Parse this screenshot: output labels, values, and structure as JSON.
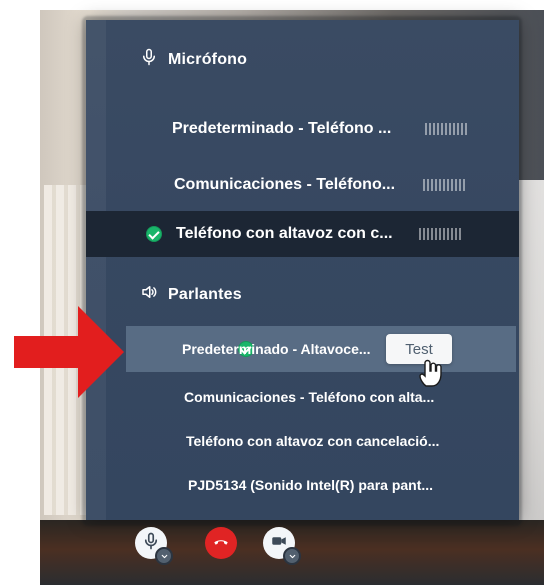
{
  "microphone": {
    "title": "Micrófono",
    "devices": [
      {
        "name": "Predeterminado - Teléfono ...",
        "selected": false
      },
      {
        "name": "Comunicaciones - Teléfono...",
        "selected": false
      },
      {
        "name": "Teléfono con altavoz con c...",
        "selected": true
      }
    ]
  },
  "speakers": {
    "title": "Parlantes",
    "devices": [
      {
        "name": "Predeterminado - Altavoce...",
        "selected": true
      },
      {
        "name": "Comunicaciones - Teléfono con alta...",
        "selected": false
      },
      {
        "name": "Teléfono con altavoz con cancelació...",
        "selected": false
      },
      {
        "name": "PJD5134 (Sonido Intel(R) para pant...",
        "selected": false
      }
    ],
    "test_label": "Test"
  },
  "controls": {
    "mic": "mic-icon",
    "hangup": "phone-hangup-icon",
    "camera": "video-camera-icon"
  },
  "colors": {
    "panel": "#374861",
    "selected_mic_row": "#1c2634",
    "selected_speaker_row": "#748aa3",
    "check": "#19b56a",
    "hangup": "#e02424",
    "arrow": "#e21e1e"
  }
}
